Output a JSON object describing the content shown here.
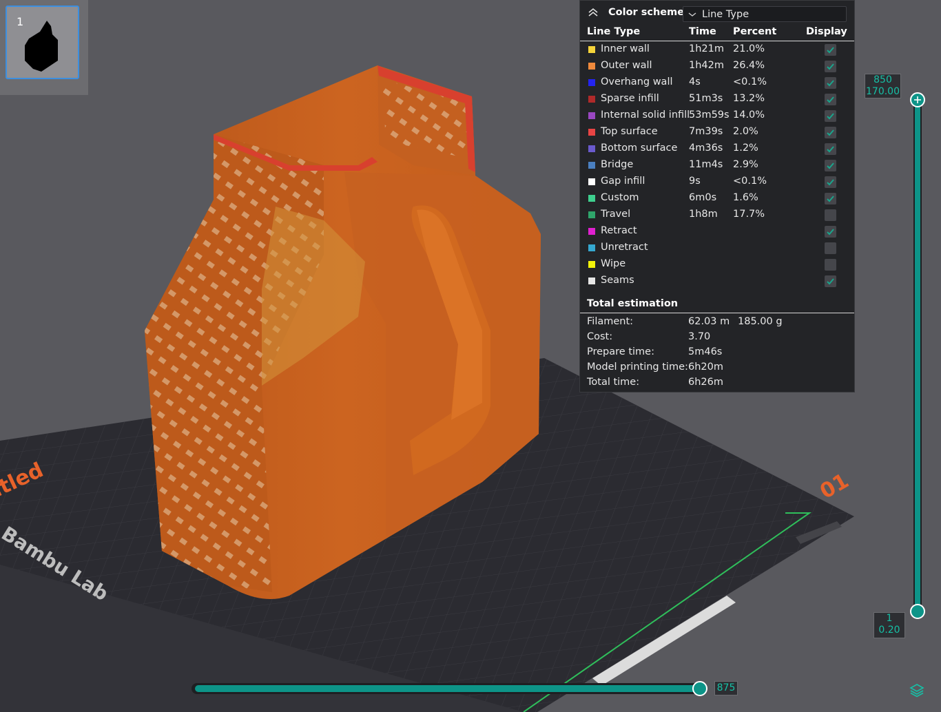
{
  "plate": {
    "number": "1"
  },
  "bed": {
    "brand_text": "Bambu Lab",
    "name_text": "ltled",
    "plate_label": "01"
  },
  "color_scheme": {
    "title": "Color scheme",
    "selected": "Line Type",
    "headers": {
      "type": "Line Type",
      "time": "Time",
      "percent": "Percent",
      "display": "Display"
    },
    "rows": [
      {
        "name": "Inner wall",
        "time": "1h21m",
        "percent": "21.0%",
        "color": "#f5d33a",
        "checked": true
      },
      {
        "name": "Outer wall",
        "time": "1h42m",
        "percent": "26.4%",
        "color": "#f08a3c",
        "checked": true
      },
      {
        "name": "Overhang wall",
        "time": "4s",
        "percent": "<0.1%",
        "color": "#2424f0",
        "checked": true
      },
      {
        "name": "Sparse infill",
        "time": "51m3s",
        "percent": "13.2%",
        "color": "#b02a2a",
        "checked": true
      },
      {
        "name": "Internal solid infill",
        "time": "53m59s",
        "percent": "14.0%",
        "color": "#9a47c2",
        "checked": true
      },
      {
        "name": "Top surface",
        "time": "7m39s",
        "percent": "2.0%",
        "color": "#e84444",
        "checked": true
      },
      {
        "name": "Bottom surface",
        "time": "4m36s",
        "percent": "1.2%",
        "color": "#6a5acd",
        "checked": true
      },
      {
        "name": "Bridge",
        "time": "11m4s",
        "percent": "2.9%",
        "color": "#4a7fc0",
        "checked": true
      },
      {
        "name": "Gap infill",
        "time": "9s",
        "percent": "<0.1%",
        "color": "#ffffff",
        "checked": true
      },
      {
        "name": "Custom",
        "time": "6m0s",
        "percent": "1.6%",
        "color": "#3ecf8e",
        "checked": true
      },
      {
        "name": "Travel",
        "time": "1h8m",
        "percent": "17.7%",
        "color": "#2fa56b",
        "checked": false
      },
      {
        "name": "Retract",
        "time": "",
        "percent": "",
        "color": "#e020d0",
        "checked": true
      },
      {
        "name": "Unretract",
        "time": "",
        "percent": "",
        "color": "#35a8d0",
        "checked": false
      },
      {
        "name": "Wipe",
        "time": "",
        "percent": "",
        "color": "#f2f20a",
        "checked": false
      },
      {
        "name": "Seams",
        "time": "",
        "percent": "",
        "color": "#e6e6e6",
        "checked": true
      }
    ]
  },
  "total_estimation": {
    "title": "Total estimation",
    "filament_label": "Filament:",
    "filament_length": "62.03 m",
    "filament_weight": "185.00 g",
    "cost_label": "Cost:",
    "cost": "3.70",
    "prepare_label": "Prepare time:",
    "prepare": "5m46s",
    "model_label": "Model printing time:",
    "model": "6h20m",
    "total_label": "Total time:",
    "total": "6h26m"
  },
  "layer_slider": {
    "top_layer": "850",
    "top_height": "170.00",
    "bottom_layer": "1",
    "bottom_height": "0.20"
  },
  "move_slider": {
    "value": "875"
  },
  "colors": {
    "accent": "#0d9488",
    "accent_text": "#16c0a6",
    "model": "#c8611e",
    "plate_label": "#e8622a"
  }
}
